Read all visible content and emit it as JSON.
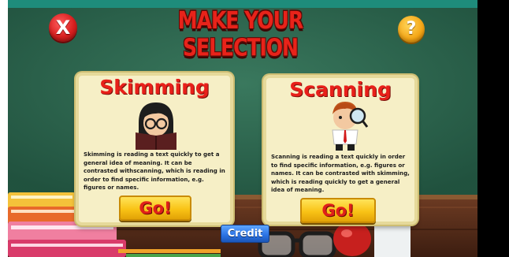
{
  "header": {
    "title": "MAKE YOUR SELECTION",
    "close_label": "X",
    "help_label": "?"
  },
  "cards": {
    "skimming": {
      "title": "Skimming",
      "description": "Skimming is reading a text quickly to get a general idea of meaning. It can be contrasted withscanning, which is reading in order to find specific information, e.g. figures or names.",
      "go_label": "Go!"
    },
    "scanning": {
      "title": "Scanning",
      "description": "Scanning is reading a text quickly in order to find specific information, e.g. figures or names. It can be contrasted with skimming, which is reading quickly to get a general idea of meaning.",
      "go_label": "Go!"
    }
  },
  "footer": {
    "credit_label": "Credit"
  },
  "colors": {
    "chalkboard": "#2f6a54",
    "wall": "#1f8a7a",
    "desk": "#5a2e1c",
    "title_red": "#e8231a",
    "card_bg": "#f6efc6",
    "go_yellow": "#f9c316",
    "credit_blue": "#2a71e2"
  }
}
